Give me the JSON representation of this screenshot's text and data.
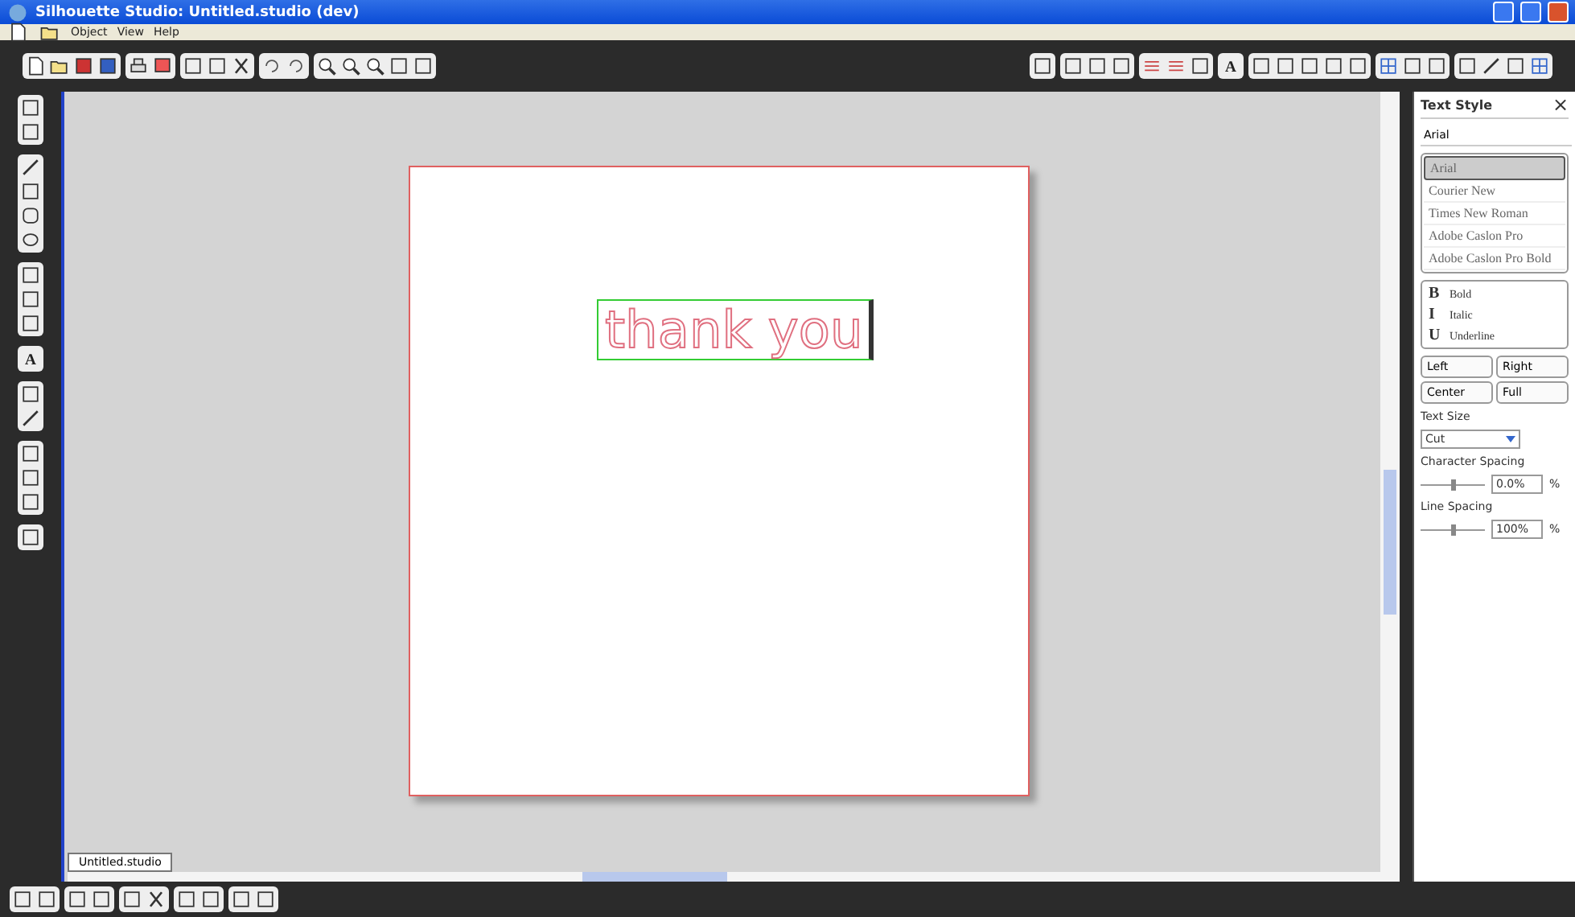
{
  "window": {
    "title": "Silhouette Studio: Untitled.studio (dev)"
  },
  "menu": [
    "Object",
    "View",
    "Help"
  ],
  "toolbar_text_glyph": "A",
  "left_text_tool_glyph": "A",
  "canvas": {
    "text": "thank you",
    "selected": true
  },
  "document_tab": {
    "label": "Untitled.studio",
    "selected": true
  },
  "panel": {
    "title": "Text Style",
    "close": "×",
    "font_field": "Arial",
    "fonts": [
      {
        "label": "Arial",
        "selected": true
      },
      {
        "label": "Courier New",
        "selected": false
      },
      {
        "label": "Times New Roman",
        "selected": false
      },
      {
        "label": "Adobe Caslon Pro",
        "selected": false
      },
      {
        "label": "Adobe Caslon Pro Bold",
        "selected": false
      }
    ],
    "styles": [
      {
        "glyph": "B",
        "label": "Bold"
      },
      {
        "glyph": "I",
        "label": "Italic"
      },
      {
        "glyph": "U",
        "label": "Underline"
      }
    ],
    "align": [
      "Left",
      "Right",
      "Center",
      "Full"
    ],
    "size_label": "Text Size",
    "size_value": "Cut",
    "char_spacing_label": "Character Spacing",
    "char_spacing": {
      "value": "0.0%",
      "unit": "%",
      "level": 0.5
    },
    "line_spacing_label": "Line Spacing",
    "line_spacing": {
      "value": "100%",
      "unit": "%",
      "level": 0.5
    }
  }
}
